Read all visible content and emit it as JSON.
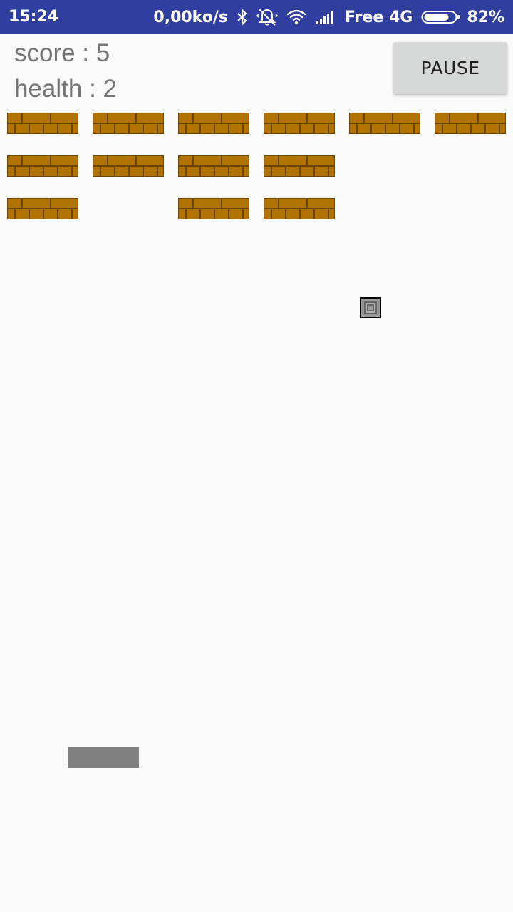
{
  "status_bar": {
    "time": "15:24",
    "network_speed": "0,00ko/s",
    "carrier": "Free 4G",
    "battery_percent": "82%",
    "battery_level": 0.82,
    "icons": [
      "bluetooth-icon",
      "muted-vibrate-icon",
      "wifi-icon",
      "cell-signal-icon",
      "battery-icon"
    ]
  },
  "hud": {
    "score": "score : 5",
    "health": "health : 2"
  },
  "controls": {
    "pause_label": "PAUSE"
  },
  "colors": {
    "status_bar": "#303f9f",
    "brick": "#b07300",
    "brick_mortar": "#6a4400",
    "paddle": "#808080",
    "hud_text": "#757575",
    "background": "#fafafa"
  },
  "bricks": {
    "columns": 6,
    "rows": 3,
    "present": [
      [
        true,
        true,
        true,
        true,
        true,
        true
      ],
      [
        true,
        true,
        true,
        true,
        false,
        false
      ],
      [
        true,
        false,
        true,
        true,
        false,
        false
      ]
    ]
  }
}
